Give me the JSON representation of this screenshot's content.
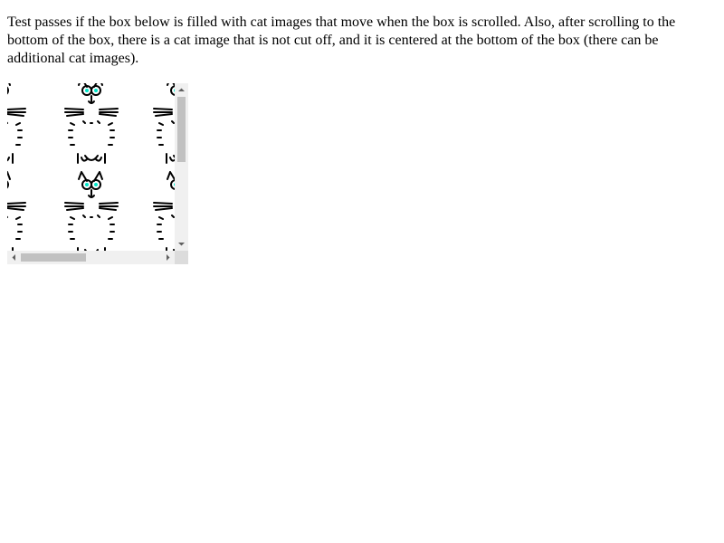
{
  "instructions": {
    "text": "Test passes if the box below is filled with cat images that move when the box is scrolled. Also, after scrolling to the bottom of the box, there is a cat image that is not cut off, and it is centered at the bottom of the box (there can be additional cat images)."
  },
  "scroll_box": {
    "background_image": "cat-pattern",
    "scroll_position_vertical": 0.0,
    "scroll_position_horizontal": 0.0
  },
  "icons": {
    "up": "scroll-up-arrow",
    "down": "scroll-down-arrow",
    "left": "scroll-left-arrow",
    "right": "scroll-right-arrow"
  },
  "colors": {
    "scrollbar_track": "#f0f0f0",
    "scrollbar_thumb": "#c1c1c1",
    "cat_eye": "#00e5c8"
  }
}
